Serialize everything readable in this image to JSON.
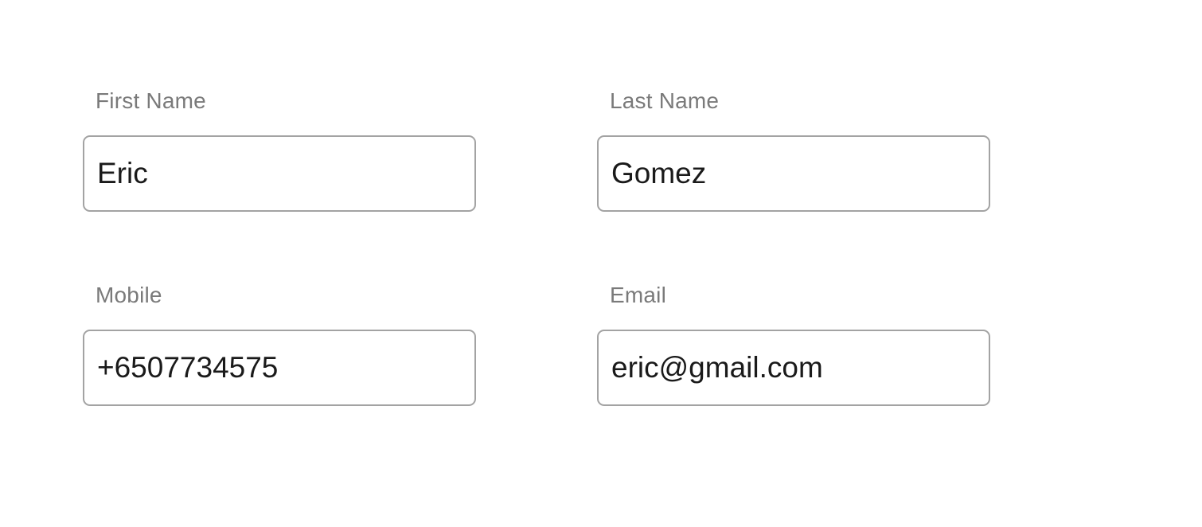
{
  "form": {
    "first_name": {
      "label": "First Name",
      "value": "Eric"
    },
    "last_name": {
      "label": "Last Name",
      "value": "Gomez"
    },
    "mobile": {
      "label": "Mobile",
      "value": "+6507734575"
    },
    "email": {
      "label": "Email",
      "value": "eric@gmail.com"
    }
  },
  "colors": {
    "label_text": "#7a7a7a",
    "input_border": "#a3a3a3",
    "input_text": "#1a1a1a",
    "background": "#ffffff"
  }
}
